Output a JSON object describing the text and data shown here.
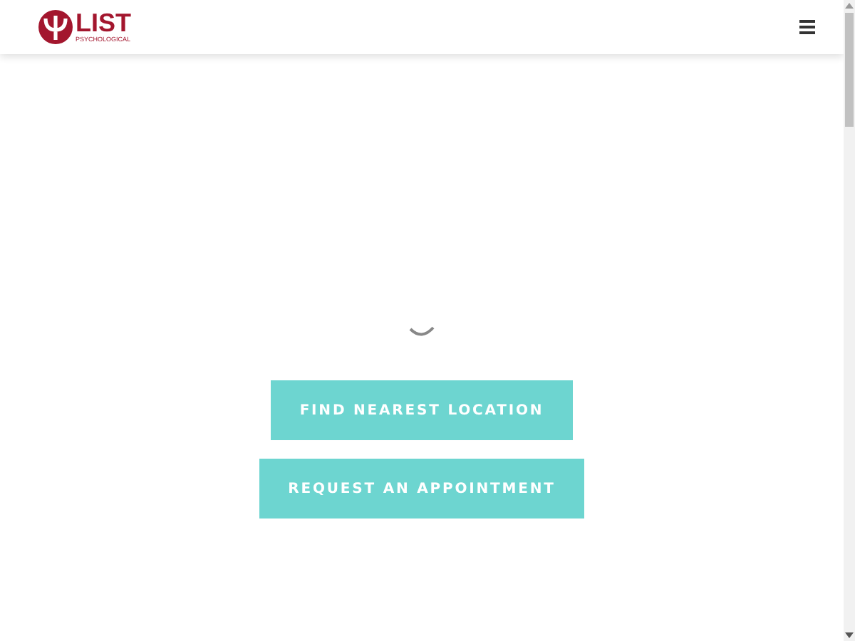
{
  "header": {
    "logo": {
      "name": "LIST",
      "tagline": "PSYCHOLOGICAL"
    }
  },
  "buttons": [
    {
      "label": "FIND NEAREST LOCATION"
    },
    {
      "label": "REQUEST AN APPOINTMENT"
    }
  ]
}
